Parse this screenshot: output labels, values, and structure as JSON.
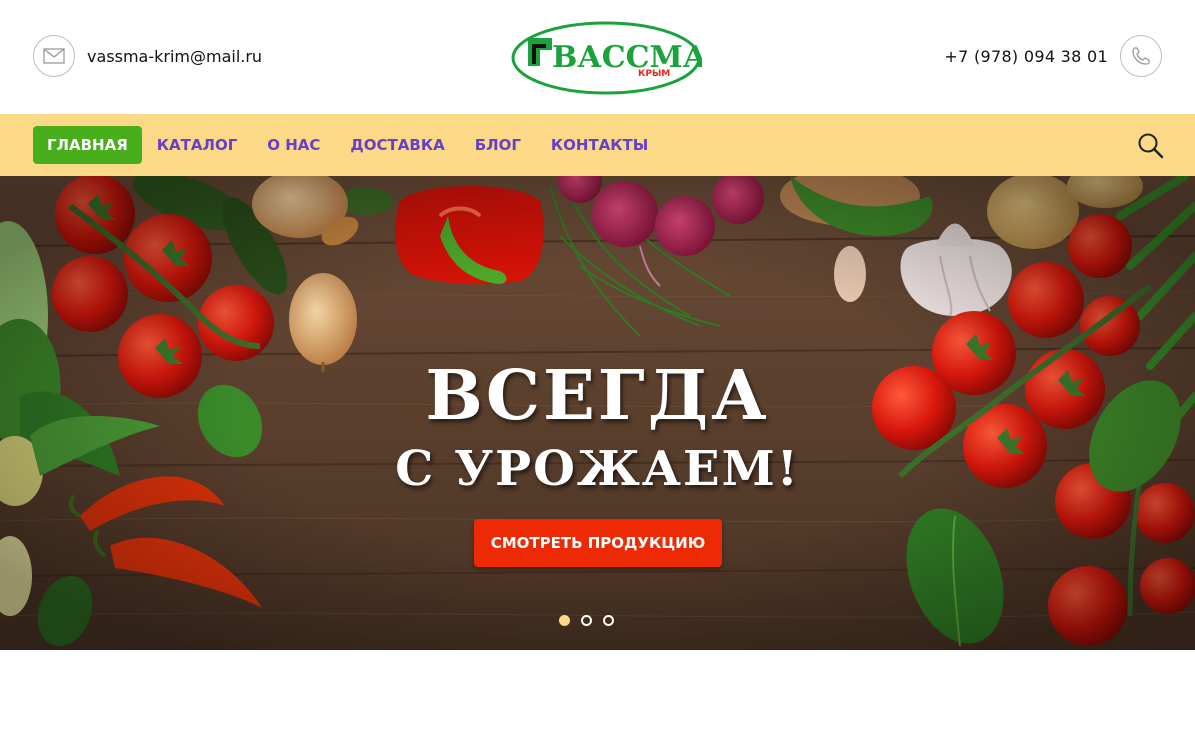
{
  "header": {
    "email": "vassma-krim@mail.ru",
    "phone": "+7 (978) 094 38 01",
    "logo": {
      "name": "ВАССМА",
      "sub": "КРЫМ"
    }
  },
  "nav": {
    "items": [
      {
        "label": "ГЛАВНАЯ",
        "active": true
      },
      {
        "label": "КАТАЛОГ"
      },
      {
        "label": "О НАС"
      },
      {
        "label": "ДОСТАВКА"
      },
      {
        "label": "БЛОГ"
      },
      {
        "label": "КОНТАКТЫ"
      }
    ],
    "search_icon": "search-icon"
  },
  "hero": {
    "title_line1": "ВСЕГДА",
    "title_line2": "С УРОЖАЕМ!",
    "cta_label": "СМОТРЕТЬ ПРОДУКЦИЮ",
    "slides": 3,
    "active_slide": 1
  },
  "colors": {
    "nav_bg": "#fcd987",
    "nav_text": "#6640c8",
    "active_bg": "#48ae1b",
    "cta_bg": "#ee2a06",
    "logo_green": "#1aa33a"
  }
}
